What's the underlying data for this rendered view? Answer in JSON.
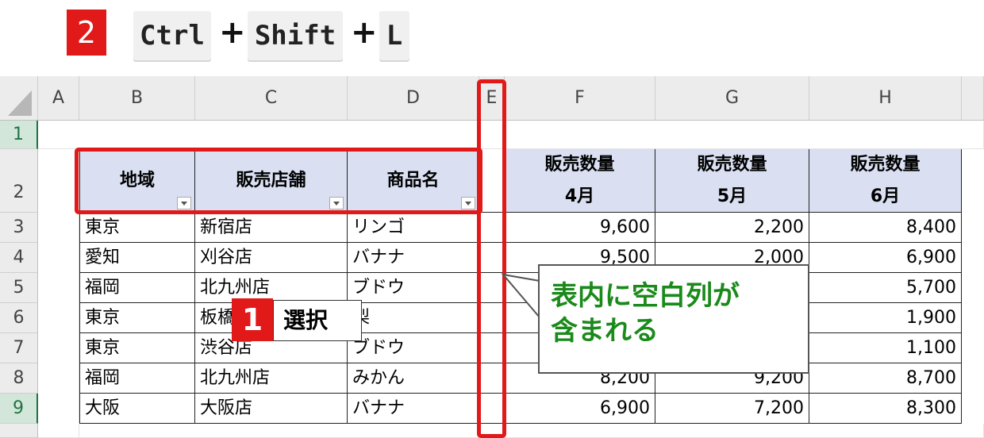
{
  "shortcut": {
    "step_number": "2",
    "keys": [
      "Ctrl",
      "Shift",
      "L"
    ],
    "plus": "+"
  },
  "columns": [
    "A",
    "B",
    "C",
    "D",
    "E",
    "F",
    "G",
    "H"
  ],
  "rows": [
    "1",
    "2",
    "3",
    "4",
    "5",
    "6",
    "7",
    "8",
    "9"
  ],
  "table": {
    "headers": {
      "region": "地域",
      "store": "販売店舗",
      "product": "商品名",
      "apr_line1": "販売数量",
      "apr_line2": "4月",
      "may_line1": "販売数量",
      "may_line2": "5月",
      "jun_line1": "販売数量",
      "jun_line2": "6月"
    },
    "data": [
      [
        "東京",
        "新宿店",
        "リンゴ",
        "9,600",
        "2,200",
        "8,400"
      ],
      [
        "愛知",
        "刈谷店",
        "バナナ",
        "9,500",
        "2,000",
        "6,900"
      ],
      [
        "福岡",
        "北九州店",
        "ブドウ",
        "",
        "",
        "5,700"
      ],
      [
        "東京",
        "板橋",
        "梨",
        "",
        "",
        "1,900"
      ],
      [
        "東京",
        "渋谷店",
        "ブドウ",
        "",
        "",
        "1,100"
      ],
      [
        "福岡",
        "北九州店",
        "みかん",
        "8,200",
        "9,200",
        "8,700"
      ],
      [
        "大阪",
        "大阪店",
        "バナナ",
        "6,900",
        "7,200",
        "8,300"
      ]
    ]
  },
  "callout_select": {
    "number": "1",
    "label": "選択"
  },
  "note": {
    "line1": "表内に空白列が",
    "line2": "含まれる"
  },
  "colors": {
    "accent_red": "#e11919",
    "header_fill": "#dae0f2",
    "note_green": "#1a8a1a",
    "row_select_green": "#217346"
  }
}
